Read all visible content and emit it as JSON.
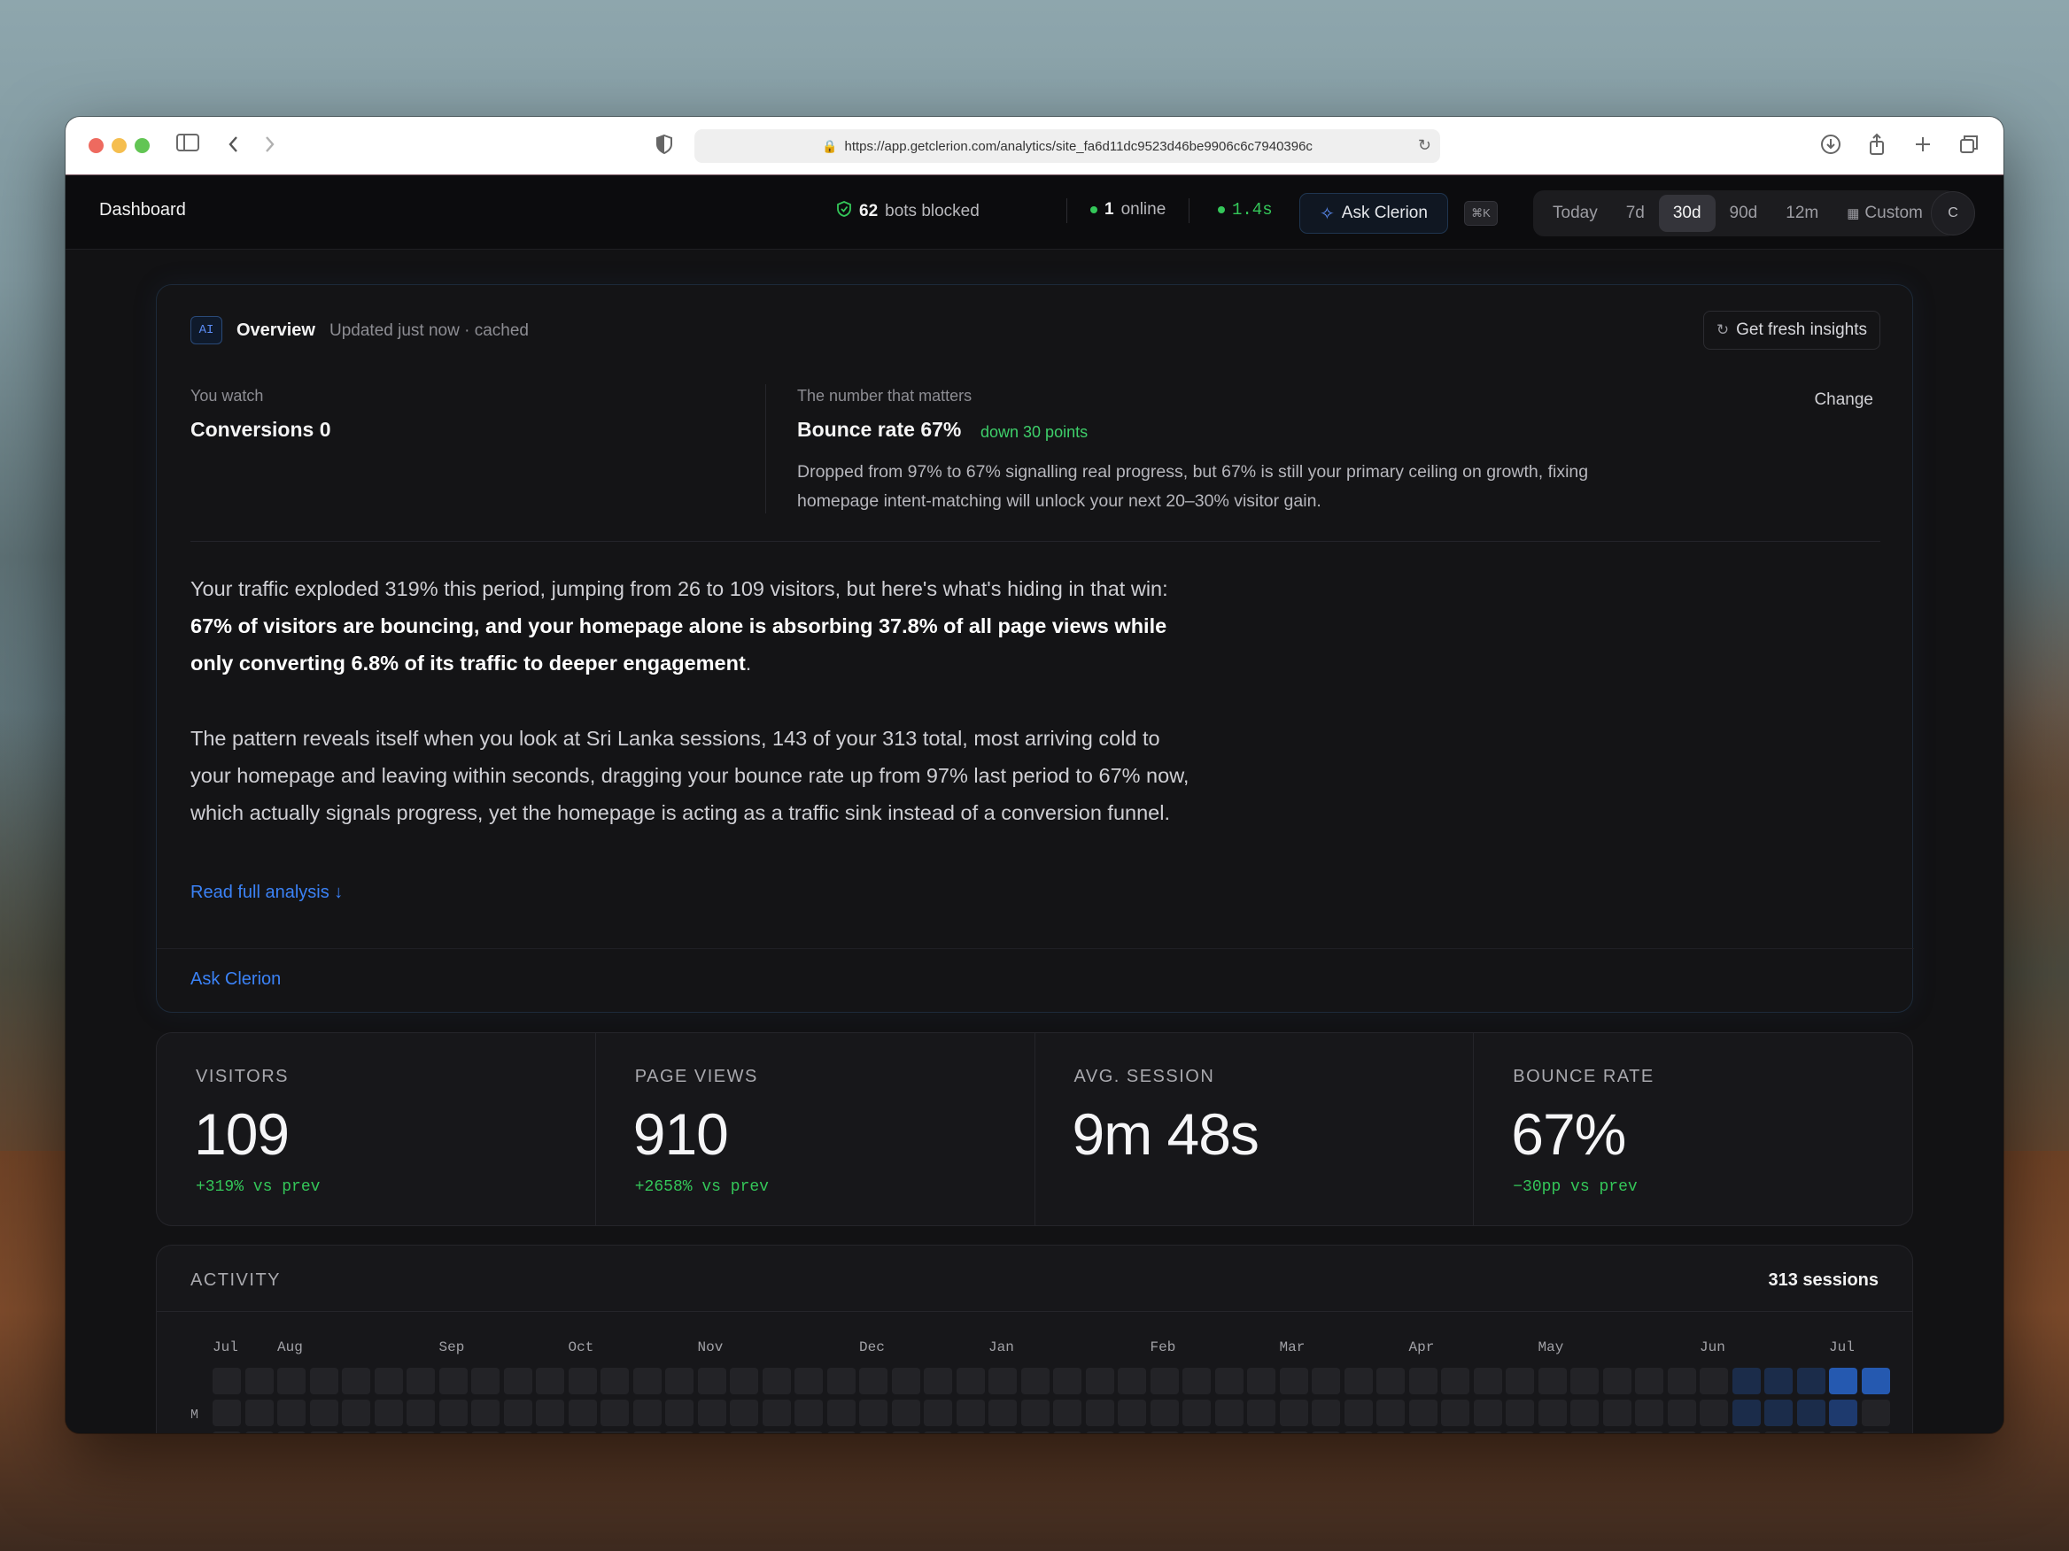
{
  "browser": {
    "url": "https://app.getclerion.com/analytics/site_fa6d11dc9523d46be9906c6c7940396c"
  },
  "topbar": {
    "title": "Dashboard",
    "bots_count": "62",
    "bots_label": "bots blocked",
    "online_count": "1",
    "online_label": "online",
    "latency": "1.4s",
    "ask_label": "Ask Clerion",
    "shortcut": "⌘K",
    "ranges": [
      "Today",
      "7d",
      "30d",
      "90d",
      "12m",
      "Custom"
    ],
    "active_range": "30d",
    "avatar_initial": "C"
  },
  "overview": {
    "badge": "AI",
    "title": "Overview",
    "subtitle": "Updated just now · cached",
    "fresh_label": "Get fresh insights",
    "watch_label": "You watch",
    "watch_value": "Conversions 0",
    "metric_label": "The number that matters",
    "metric_value": "Bounce rate 67%",
    "metric_delta": "down 30 points",
    "change_label": "Change",
    "insight": "Dropped from 97% to 67% signalling real progress, but 67% is still your primary ceiling on growth, fixing homepage intent-matching will unlock your next 20–30% visitor gain.",
    "para1_plain": "Your traffic exploded 319% this period, jumping from 26 to 109 visitors, but here's what's hiding in that win: ",
    "para1_bold": "67% of visitors are bouncing, and your homepage alone is absorbing 37.8% of all page views while only converting 6.8% of its traffic to deeper engagement",
    "para1_end": ".",
    "para2": "The pattern reveals itself when you look at Sri Lanka sessions, 143 of your 313 total, most arriving cold to your homepage and leaving within seconds, dragging your bounce rate up from 97% last period to 67% now, which actually signals progress, yet the homepage is acting as a traffic sink instead of a conversion funnel.",
    "read_full": "Read full analysis ↓",
    "ask_link": "Ask Clerion"
  },
  "metrics": [
    {
      "label": "VISITORS",
      "value": "109",
      "delta": "+319% vs prev"
    },
    {
      "label": "PAGE VIEWS",
      "value": "910",
      "delta": "+2658% vs prev"
    },
    {
      "label": "AVG. SESSION",
      "value": "9m 48s",
      "delta": ""
    },
    {
      "label": "BOUNCE RATE",
      "value": "67%",
      "delta": "−30pp vs prev"
    }
  ],
  "activity": {
    "title": "ACTIVITY",
    "sessions": "313 sessions",
    "months": [
      "Jul",
      "Aug",
      "Sep",
      "Oct",
      "Nov",
      "Dec",
      "Jan",
      "Feb",
      "Mar",
      "Apr",
      "May",
      "Jun",
      "Jul"
    ],
    "day_label": "M",
    "weeks": 52,
    "active_weeks": [
      {
        "week": 47,
        "level": 1
      },
      {
        "week": 48,
        "level": 1
      },
      {
        "week": 49,
        "level": 1
      },
      {
        "week": 50,
        "level": 3
      },
      {
        "week": 51,
        "level": 3
      }
    ],
    "active_weeks_row2": [
      {
        "week": 47,
        "level": 1
      },
      {
        "week": 48,
        "level": 1
      },
      {
        "week": 49,
        "level": 1
      },
      {
        "week": 50,
        "level": 2
      }
    ],
    "colors": {
      "empty": "#232327",
      "level1": "#1b2c4a",
      "level2": "#1e3a6e",
      "level3": "#2559b0"
    }
  }
}
